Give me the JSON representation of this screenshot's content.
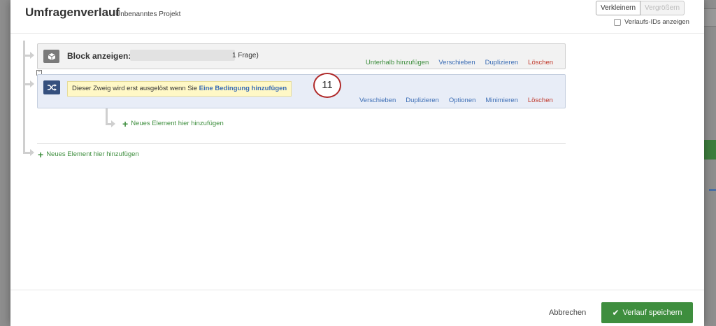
{
  "header": {
    "title": "Umfragenverlauf",
    "project_name": "Unbenanntes Projekt",
    "zoom_out_label": "Verkleinern",
    "zoom_in_label": "Vergrößern",
    "show_ids_label": "Verlaufs-IDs anzeigen"
  },
  "block": {
    "label": "Block anzeigen:",
    "question_count": "1 Frage)",
    "actions": {
      "add_below": "Unterhalb hinzufügen",
      "move": "Verschieben",
      "duplicate": "Duplizieren",
      "delete": "Löschen"
    }
  },
  "branch": {
    "condition_text": "Dieser Zweig wird erst ausgelöst wenn Sie",
    "condition_link": "Eine Bedingung hinzufügen",
    "badge": "11",
    "actions": {
      "move": "Verschieben",
      "duplicate": "Duplizieren",
      "options": "Optionen",
      "minimize": "Minimieren",
      "delete": "Löschen"
    },
    "add_new_label": "Neues Element hier hinzufügen"
  },
  "root": {
    "add_new_label": "Neues Element hier hinzufügen"
  },
  "footer": {
    "cancel_label": "Abbrechen",
    "save_label": "Verlauf speichern"
  },
  "colors": {
    "green": "#3e8e3e",
    "blue": "#3b6db5",
    "red": "#c0392b",
    "branch_icon": "#35507e",
    "block_icon": "#7a7a7a"
  }
}
